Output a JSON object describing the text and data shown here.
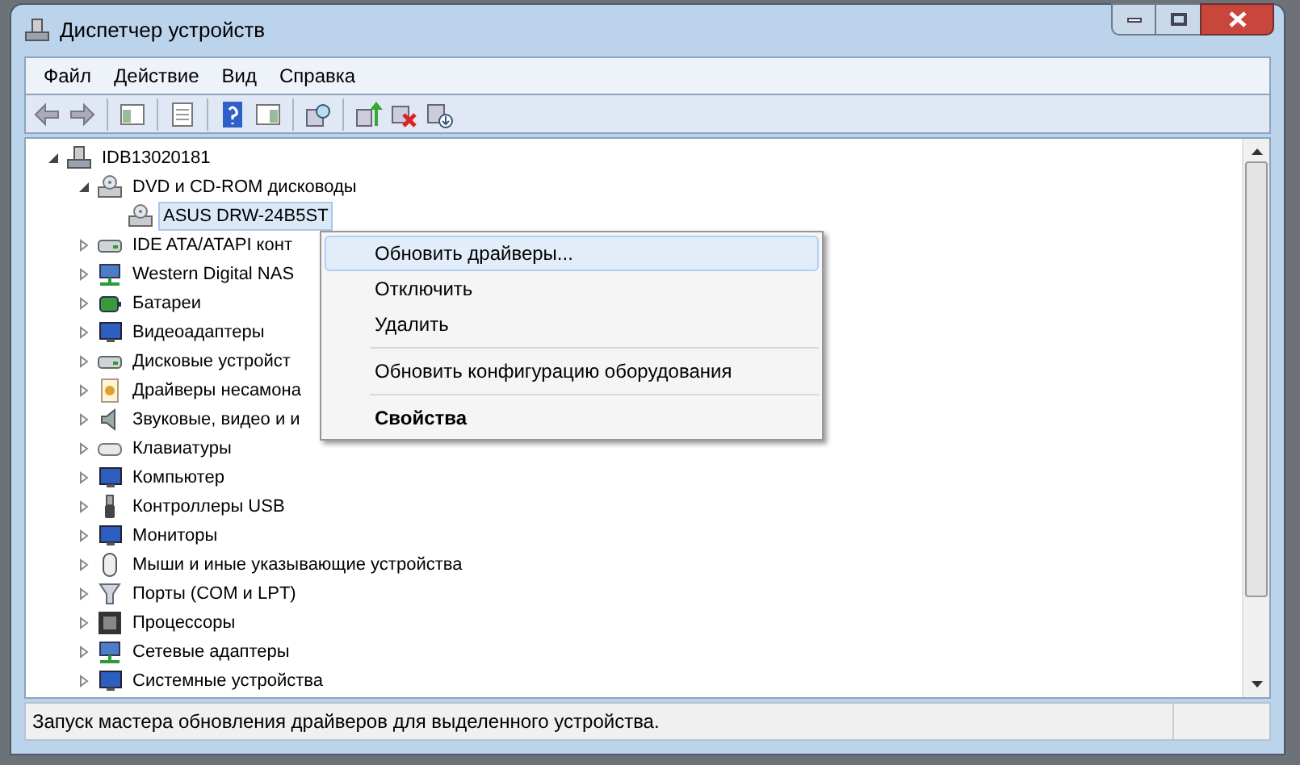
{
  "window": {
    "title": "Диспетчер устройств"
  },
  "menu": [
    "Файл",
    "Действие",
    "Вид",
    "Справка"
  ],
  "tree": [
    {
      "label": "IDB13020181",
      "kind": "computer",
      "expanded": true,
      "children": [
        {
          "label": "DVD и CD-ROM дисководы",
          "kind": "dvd",
          "expanded": true,
          "children": [
            {
              "label": "ASUS DRW-24B5ST",
              "kind": "dvd",
              "selected": true
            }
          ]
        },
        {
          "label": "IDE ATA/ATAPI конт",
          "kind": "disk",
          "expanded": false,
          "selected": false
        },
        {
          "label": "Western Digital NAS",
          "kind": "network",
          "expanded": false,
          "selected": false
        },
        {
          "label": "Батареи",
          "kind": "battery",
          "expanded": false,
          "selected": false
        },
        {
          "label": "Видеоадаптеры",
          "kind": "monitor",
          "expanded": false,
          "selected": false
        },
        {
          "label": "Дисковые устройст",
          "kind": "disk",
          "expanded": false,
          "selected": false
        },
        {
          "label": "Драйверы несамона",
          "kind": "driver",
          "expanded": false,
          "selected": false
        },
        {
          "label": "Звуковые, видео и и",
          "kind": "sound",
          "expanded": false,
          "selected": false
        },
        {
          "label": "Клавиатуры",
          "kind": "keyboard",
          "expanded": false,
          "selected": false
        },
        {
          "label": "Компьютер",
          "kind": "monitor",
          "expanded": false,
          "selected": false
        },
        {
          "label": "Контроллеры USB",
          "kind": "usb",
          "expanded": false,
          "selected": false
        },
        {
          "label": "Мониторы",
          "kind": "monitor",
          "expanded": false,
          "selected": false
        },
        {
          "label": "Мыши и иные указывающие устройства",
          "kind": "mouse",
          "expanded": false,
          "selected": false
        },
        {
          "label": "Порты (COM и LPT)",
          "kind": "port",
          "expanded": false,
          "selected": false
        },
        {
          "label": "Процессоры",
          "kind": "cpu",
          "expanded": false,
          "selected": false
        },
        {
          "label": "Сетевые адаптеры",
          "kind": "network",
          "expanded": false,
          "selected": false
        },
        {
          "label": "Системные устройства",
          "kind": "monitor",
          "expanded": false,
          "selected": false
        }
      ]
    }
  ],
  "context_menu": [
    {
      "kind": "item",
      "label": "Обновить драйверы...",
      "selected": true
    },
    {
      "kind": "item",
      "label": "Отключить",
      "selected": false
    },
    {
      "kind": "item",
      "label": "Удалить",
      "selected": false
    },
    {
      "kind": "separator"
    },
    {
      "kind": "item",
      "label": "Обновить конфигурацию оборудования",
      "selected": false
    },
    {
      "kind": "separator"
    },
    {
      "kind": "default",
      "label": "Свойства",
      "selected": false
    }
  ],
  "status_bar": "Запуск мастера обновления драйверов для выделенного устройства."
}
